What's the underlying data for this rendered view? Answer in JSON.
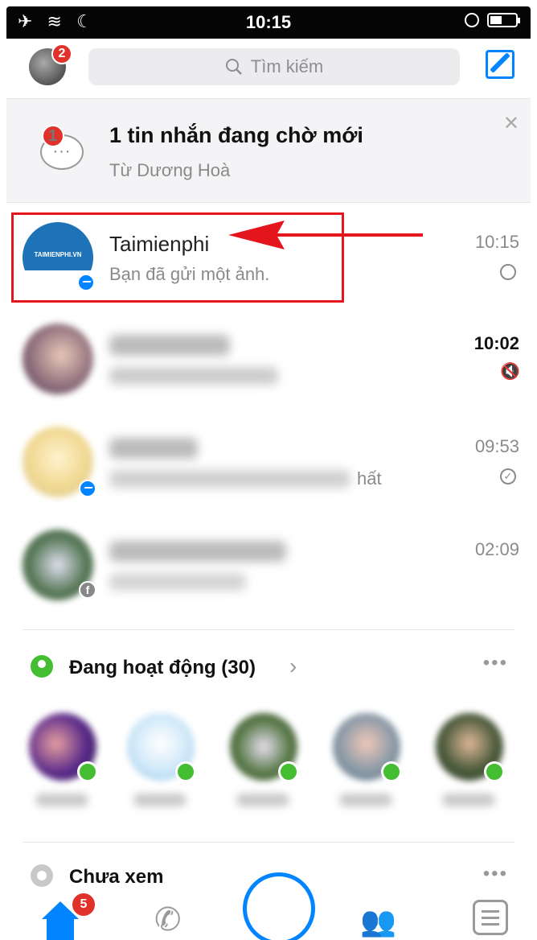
{
  "status_bar": {
    "left_icons": "✈ ≋ ☾",
    "time": "10:15",
    "battery_level": 0.45
  },
  "header": {
    "profile_badge": "2",
    "search_placeholder": "Tìm kiếm"
  },
  "pending": {
    "badge": "1",
    "title": "1 tin nhắn đang chờ mới",
    "subtitle": "Từ Dương Hoà"
  },
  "conversations": [
    {
      "name": "Taimienphi",
      "preview": "Bạn đã gửi một ảnh.",
      "time": "10:15",
      "avatar_text": "TAIMIENPHI.VN"
    },
    {
      "name": "",
      "preview": "",
      "time": "10:02"
    },
    {
      "name": "",
      "preview": "hất",
      "time": "09:53"
    },
    {
      "name": "",
      "preview": "",
      "time": "02:09"
    }
  ],
  "active": {
    "label": "Đang hoạt động (30)"
  },
  "unseen": {
    "label": "Chưa xem"
  },
  "tabbar": {
    "home_badge": "5"
  },
  "colors": {
    "accent": "#0084ff",
    "badge": "#e0312a",
    "online": "#44bd32",
    "highlight": "#e4161b"
  }
}
